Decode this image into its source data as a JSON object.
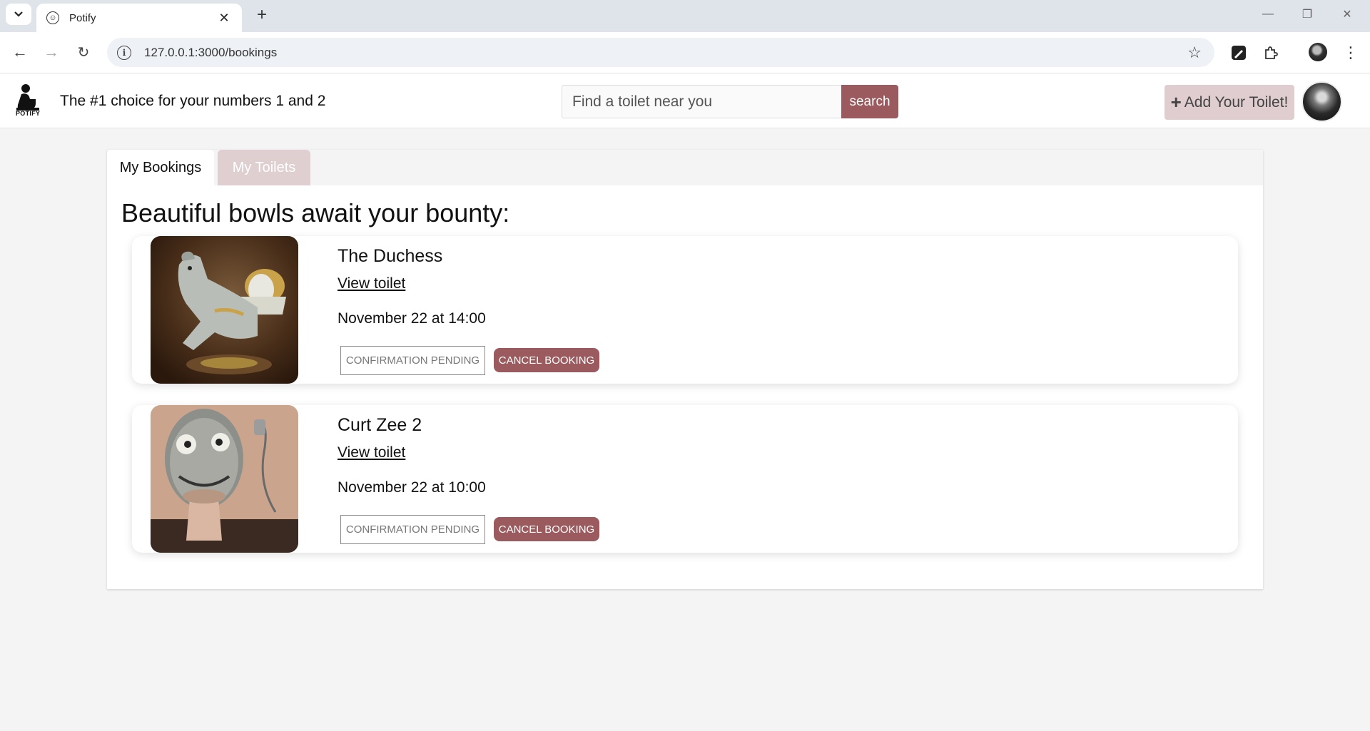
{
  "browser": {
    "tab_title": "Potify",
    "url": "127.0.0.1:3000/bookings"
  },
  "header": {
    "logo_text": "POTIFY",
    "tagline": "The #1 choice for your numbers 1 and 2",
    "search_placeholder": "Find a toilet near you",
    "search_button": "search",
    "add_toilet_label": "Add Your Toilet!"
  },
  "tabs": {
    "bookings": "My Bookings",
    "toilets": "My Toilets"
  },
  "page_title": "Beautiful bowls await your bounty:",
  "bookings": [
    {
      "name": "The Duchess",
      "link": "View toilet",
      "date": "November 22 at 14:00",
      "status": "CONFIRMATION PENDING",
      "cancel": "CANCEL BOOKING"
    },
    {
      "name": "Curt Zee 2",
      "link": "View toilet",
      "date": "November 22 at 10:00",
      "status": "CONFIRMATION PENDING",
      "cancel": "CANCEL BOOKING"
    }
  ],
  "colors": {
    "accent": "#9a5a5e",
    "accent_light": "#e0cdd0",
    "tab_inactive": "#dfcfd1"
  }
}
